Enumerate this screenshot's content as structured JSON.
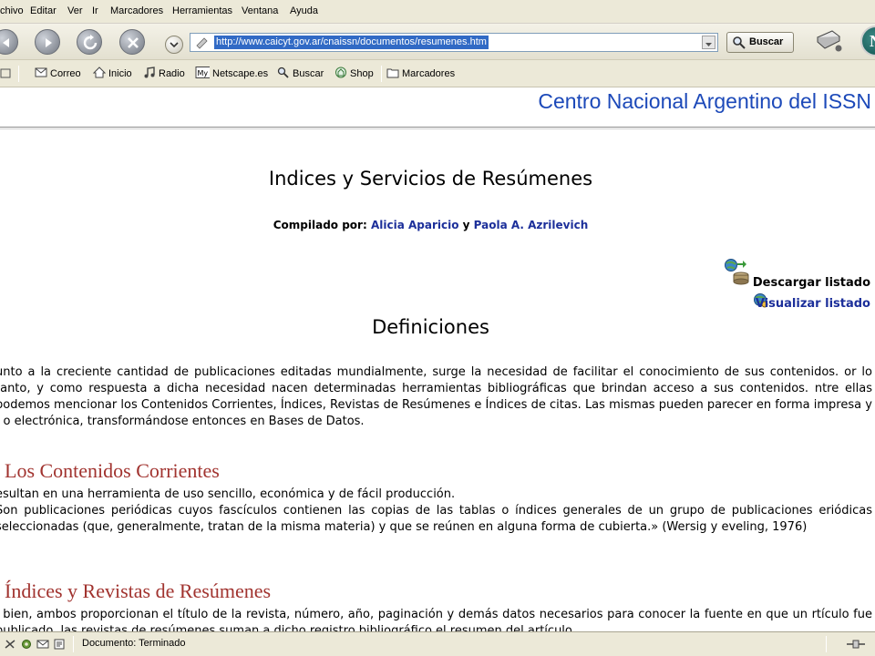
{
  "menubar": {
    "items": [
      "chivo",
      "Editar",
      "Ver",
      "Ir",
      "Marcadores",
      "Herramientas",
      "Ventana",
      "Ayuda"
    ]
  },
  "navbar": {
    "url": "http://www.caicyt.gov.ar/cnaissn/documentos/resumenes.htm",
    "search_label": "Buscar"
  },
  "personal_toolbar": {
    "items": [
      "Correo",
      "Inicio",
      "Radio",
      "Netscape.es",
      "Buscar",
      "Shop",
      "Marcadores"
    ]
  },
  "page": {
    "site_title": "Centro Nacional Argentino del ISSN",
    "title": "Indices y Servicios de Resúmenes",
    "compiled_label": "Compilado por:",
    "author1": "Alicia Aparicio",
    "conjunction": "y",
    "author2": "Paola A. Azrilevich",
    "download_label": "Descargar listado",
    "view_label": "Visualizar listado",
    "definitions_heading": "Definiciones",
    "intro_paragraph": "unto a la creciente cantidad de publicaciones editadas mundialmente, surge la necesidad de facilitar el conocimiento de sus contenidos. or lo tanto, y como respuesta a dicha necesidad nacen determinadas herramientas bibliográficas que brindan acceso a sus contenidos. ntre ellas podemos mencionar los Contenidos Corrientes, Índices, Revistas de Resúmenes e Índices de citas. Las mismas pueden parecer en forma impresa y / o electrónica, transformándose entonces en Bases de Datos.",
    "section1_heading": "Los Contenidos Corrientes",
    "section1_line1": "esultan en una herramienta de uso sencillo, económica y de fácil producción.",
    "section1_line2": "Son publicaciones periódicas cuyos fascículos contienen las copias de las tablas o índices generales de un grupo de publicaciones eriódicas seleccionadas (que, generalmente, tratan de la misma materia) y que se reúnen en alguna forma de cubierta.» (Wersig y eveling, 1976)",
    "section2_heading": "Índices y Revistas de Resúmenes",
    "section2_line1": "i bien, ambos proporcionan el título de la revista, número, año, paginación y demás datos necesarios para conocer la fuente en que un rtículo fue publicado, las revistas de resúmenes suman a dicho registro bibliográfico el resumen del artículo."
  },
  "statusbar": {
    "text": "Documento: Terminado"
  },
  "colors": {
    "site_title": "#1c49b9",
    "section_heading": "#a1332f",
    "link": "#1c2f9a"
  }
}
